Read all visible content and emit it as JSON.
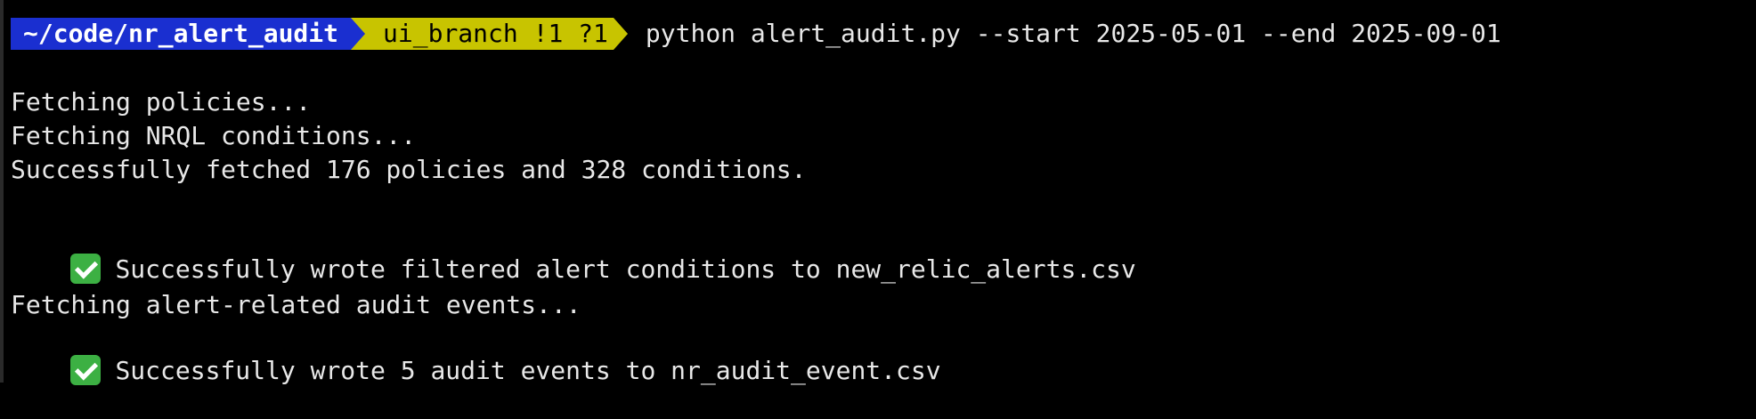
{
  "prompt": {
    "directory": "~/code/nr_alert_audit",
    "git_branch": "ui_branch !1 ?1",
    "command": "python alert_audit.py --start 2025-05-01 --end 2025-09-01"
  },
  "output": {
    "line1": "Fetching policies...",
    "line2": "Fetching NRQL conditions...",
    "line3": "Successfully fetched 176 policies and 328 conditions.",
    "line4": "Successfully wrote filtered alert conditions to new_relic_alerts.csv",
    "line5": "Fetching alert-related audit events...",
    "line6": "Successfully wrote 5 audit events to nr_audit_event.csv"
  },
  "icons": {
    "success": "check-mark-icon"
  },
  "colors": {
    "background": "#000000",
    "text": "#e8e8e8",
    "dir_segment": "#1a2fd0",
    "git_segment": "#c8c400",
    "check_green": "#3cb043"
  }
}
